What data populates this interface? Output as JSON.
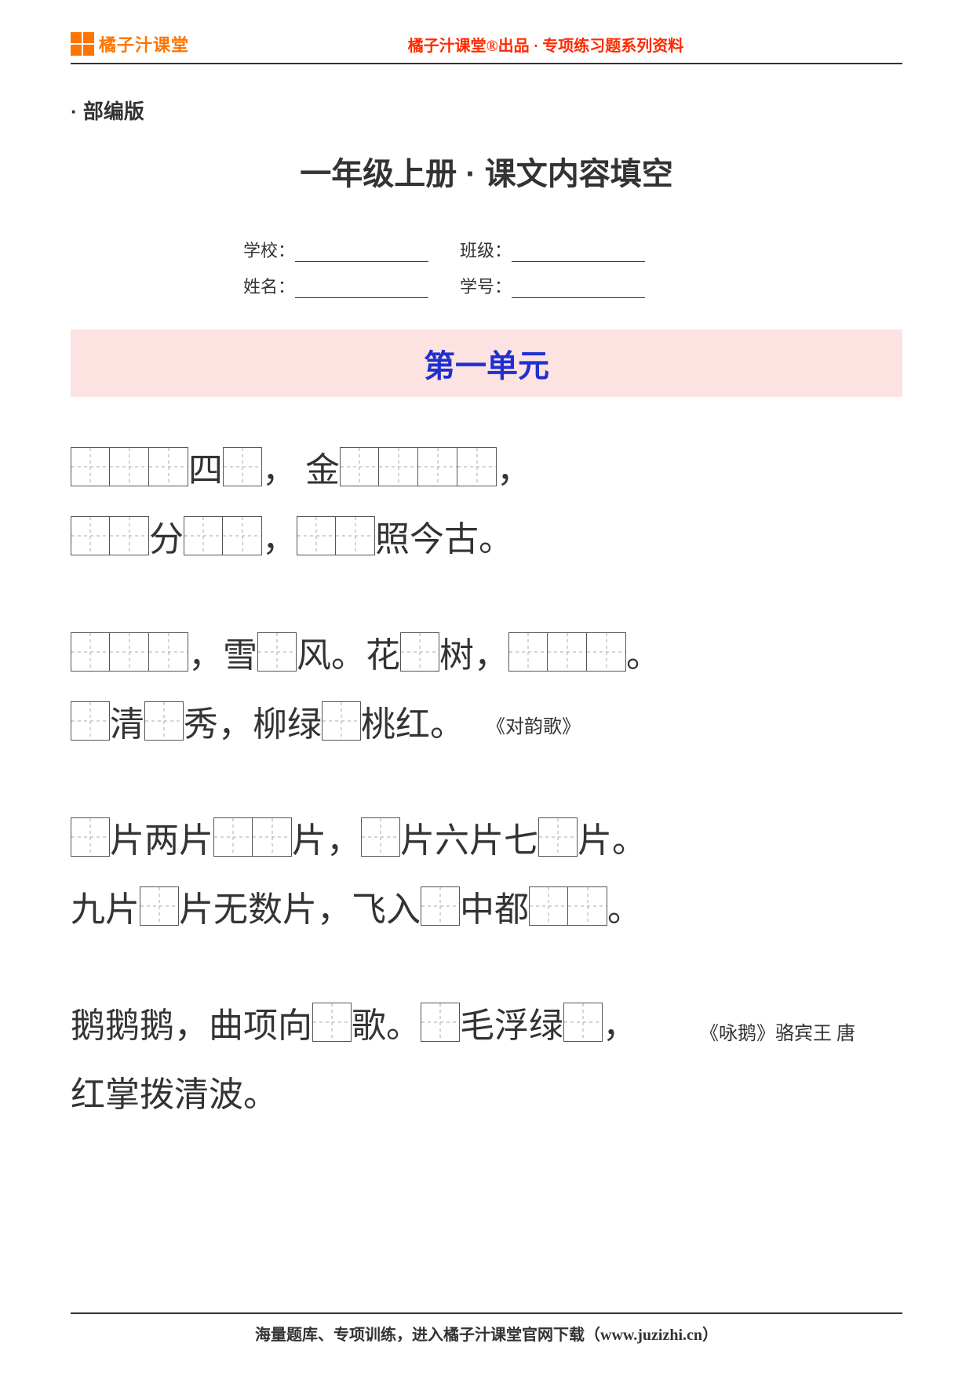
{
  "header": {
    "brand": "橘子汁课堂",
    "tagline": "橘子汁课堂®出品 · 专项练习题系列资料"
  },
  "edition": "· 部编版",
  "title": "一年级上册 · 课文内容填空",
  "info": {
    "school_label": "学校：",
    "class_label": "班级：",
    "name_label": "姓名：",
    "id_label": "学号："
  },
  "unit_title": "第一单元",
  "stanzas": [
    {
      "lines": [
        [
          {
            "t": "box",
            "n": 3
          },
          {
            "t": "txt",
            "v": "四"
          },
          {
            "t": "box",
            "n": 1
          },
          {
            "t": "txt",
            "v": "，  金"
          },
          {
            "t": "box",
            "n": 4
          },
          {
            "t": "txt",
            "v": "，"
          }
        ],
        [
          {
            "t": "box",
            "n": 2
          },
          {
            "t": "txt",
            "v": "分"
          },
          {
            "t": "box",
            "n": 2
          },
          {
            "t": "txt",
            "v": "，"
          },
          {
            "t": "box",
            "n": 2
          },
          {
            "t": "txt",
            "v": "照今古。"
          }
        ]
      ]
    },
    {
      "lines": [
        [
          {
            "t": "box",
            "n": 3
          },
          {
            "t": "txt",
            "v": "，雪"
          },
          {
            "t": "box",
            "n": 1
          },
          {
            "t": "txt",
            "v": "风。花"
          },
          {
            "t": "box",
            "n": 1
          },
          {
            "t": "txt",
            "v": "树，"
          },
          {
            "t": "box",
            "n": 3
          },
          {
            "t": "txt",
            "v": "。"
          }
        ],
        [
          {
            "t": "box",
            "n": 1
          },
          {
            "t": "txt",
            "v": "清"
          },
          {
            "t": "box",
            "n": 1
          },
          {
            "t": "txt",
            "v": "秀，柳绿"
          },
          {
            "t": "box",
            "n": 1
          },
          {
            "t": "txt",
            "v": "桃红。"
          },
          {
            "t": "cite",
            "v": "《对韵歌》"
          }
        ]
      ]
    },
    {
      "lines": [
        [
          {
            "t": "box",
            "n": 1
          },
          {
            "t": "txt",
            "v": "片两片"
          },
          {
            "t": "box",
            "n": 2
          },
          {
            "t": "txt",
            "v": "片，"
          },
          {
            "t": "box",
            "n": 1
          },
          {
            "t": "txt",
            "v": "片六片七"
          },
          {
            "t": "box",
            "n": 1
          },
          {
            "t": "txt",
            "v": "片。"
          }
        ],
        [
          {
            "t": "txt",
            "v": "九片"
          },
          {
            "t": "box",
            "n": 1
          },
          {
            "t": "txt",
            "v": "片无数片，飞入"
          },
          {
            "t": "box",
            "n": 1
          },
          {
            "t": "txt",
            "v": "中都"
          },
          {
            "t": "box",
            "n": 2
          },
          {
            "t": "txt",
            "v": "。"
          }
        ]
      ]
    },
    {
      "lines": [
        [
          {
            "t": "txt",
            "v": "鹅鹅鹅，曲项向"
          },
          {
            "t": "box",
            "n": 1
          },
          {
            "t": "txt",
            "v": "歌。"
          },
          {
            "t": "box",
            "n": 1
          },
          {
            "t": "txt",
            "v": "毛浮绿"
          },
          {
            "t": "box",
            "n": 1
          },
          {
            "t": "txt",
            "v": "，"
          }
        ],
        [
          {
            "t": "txt",
            "v": "红掌拨清波。"
          },
          {
            "t": "cite-right",
            "v": "《咏鹅》骆宾王 唐"
          }
        ]
      ]
    }
  ],
  "footer": "海量题库、专项训练，进入橘子汁课堂官网下载（www.juzizhi.cn）"
}
